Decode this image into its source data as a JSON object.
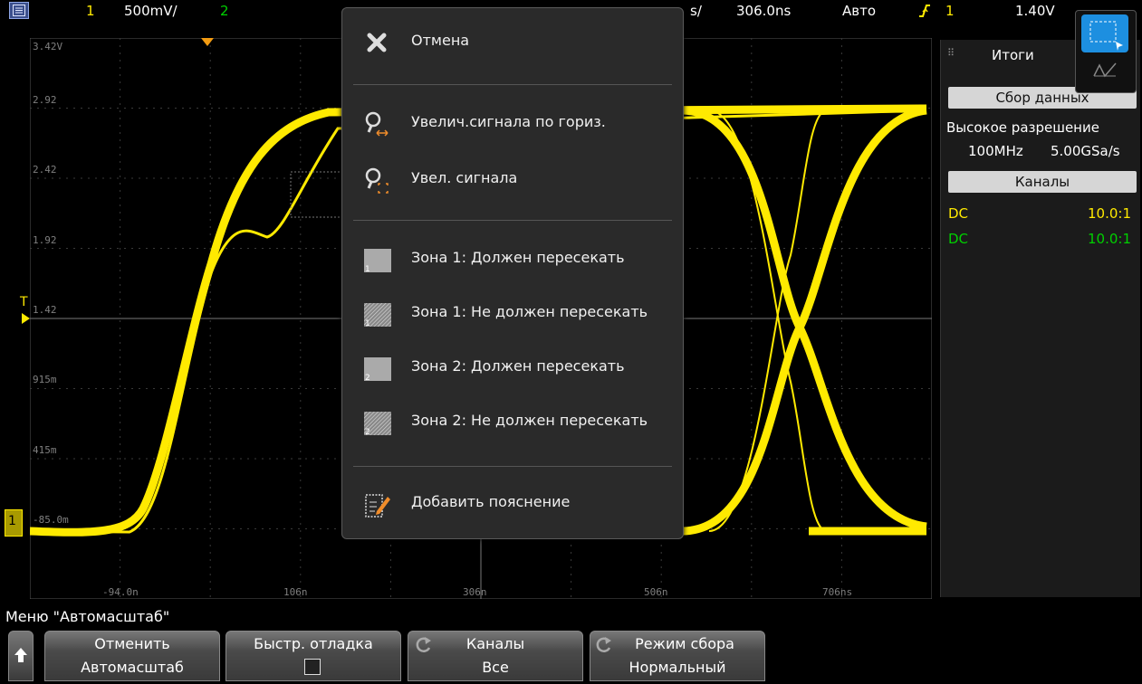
{
  "topbar": {
    "ch1_num": "1",
    "ch1_scale": "500mV/",
    "ch2_num": "2",
    "time_scale_suffix": "s/",
    "delay": "306.0ns",
    "trigger_mode": "Авто",
    "trigger_source": "1",
    "trigger_level": "1.40V",
    "colors": {
      "ch1": "#ffea00",
      "ch2": "#00d000",
      "trigger": "#ffea00"
    }
  },
  "graticule": {
    "y_labels": [
      "3.42V",
      "2.92",
      "2.42",
      "1.92",
      "1.42",
      "915m",
      "415m",
      "-85.0m"
    ],
    "x_labels": [
      "-94.0n",
      "106n",
      "306n",
      "506n",
      "706ns"
    ],
    "trigger_marker": "T",
    "ground_marker": "1"
  },
  "context_menu": {
    "items": [
      {
        "label": "Отмена",
        "icon": "close-icon"
      },
      {
        "label": "Увелич.сигнала по гориз.",
        "icon": "horizontal-zoom-icon"
      },
      {
        "label": "Увел. сигнала",
        "icon": "zoom-icon"
      },
      {
        "label": "Зона 1: Должен пересекать",
        "icon": "zone-1-must-intersect-icon"
      },
      {
        "label": "Зона 1: Не должен пересекать",
        "icon": "zone-1-must-not-intersect-icon"
      },
      {
        "label": "Зона 2: Должен пересекать",
        "icon": "zone-2-must-intersect-icon"
      },
      {
        "label": "Зона 2: Не должен пересекать",
        "icon": "zone-2-must-not-intersect-icon"
      },
      {
        "label": "Добавить пояснение",
        "icon": "annotation-icon"
      }
    ]
  },
  "side_panel": {
    "title": "Итоги",
    "acq_button": "Сбор данных",
    "acq_mode": "Высокое разрешение",
    "bandwidth": "100MHz",
    "sample_rate": "5.00GSa/s",
    "channels_button": "Каналы",
    "channels": [
      {
        "coupling": "DC",
        "probe": "10.0:1",
        "color": "#ffea00"
      },
      {
        "coupling": "DC",
        "probe": "10.0:1",
        "color": "#00d000"
      }
    ]
  },
  "bottom": {
    "menu_title": "Меню \"Автомасштаб\"",
    "softkeys": [
      {
        "line1": "Отменить",
        "line2": "Автомасштаб"
      },
      {
        "line1": "Быстр. отладка",
        "line2": ""
      },
      {
        "line1": "Каналы",
        "line2": "Все"
      },
      {
        "line1": "Режим сбора",
        "line2": "Нормальный"
      }
    ]
  }
}
